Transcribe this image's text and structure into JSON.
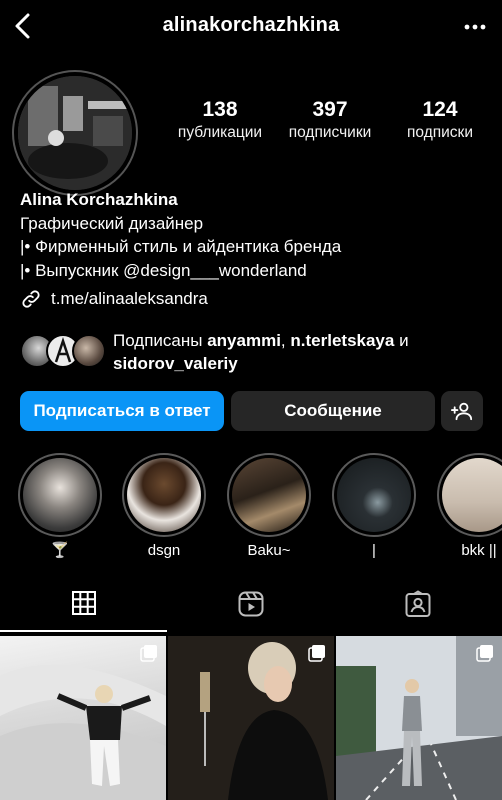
{
  "header": {
    "username": "alinakorchazhkina",
    "back_icon": "chevron-left-icon",
    "more_icon": "more-horizontal-icon"
  },
  "stats": [
    {
      "value": "138",
      "label": "публикации"
    },
    {
      "value": "397",
      "label": "подписчики"
    },
    {
      "value": "124",
      "label": "подписки"
    }
  ],
  "bio": {
    "name": "Alina Korchazhkina",
    "lines": [
      "Графический дизайнер",
      "|• Фирменный стиль и айдентика бренда",
      "|• Выпускник @design___wonderland"
    ],
    "link": "t.me/alinaaleksandra"
  },
  "followed_by": {
    "prefix": "Подписаны",
    "user1": "anyammi",
    "separator": ",",
    "user2": "n.terletskaya",
    "conj": "и",
    "user3": "sidorov_valeriy"
  },
  "actions": {
    "follow_back": "Подписаться в ответ",
    "message": "Сообщение",
    "add_user_icon": "add-person-icon"
  },
  "highlights": [
    {
      "label": "🍸"
    },
    {
      "label": "dsgn"
    },
    {
      "label": "Baku~"
    },
    {
      "label": "|"
    },
    {
      "label": "bkk ||"
    }
  ],
  "tabs": [
    "grid-icon",
    "reels-icon",
    "tagged-icon"
  ],
  "colors": {
    "background": "#000000",
    "follow_button": "#0a95f6",
    "secondary_button": "#262626"
  }
}
